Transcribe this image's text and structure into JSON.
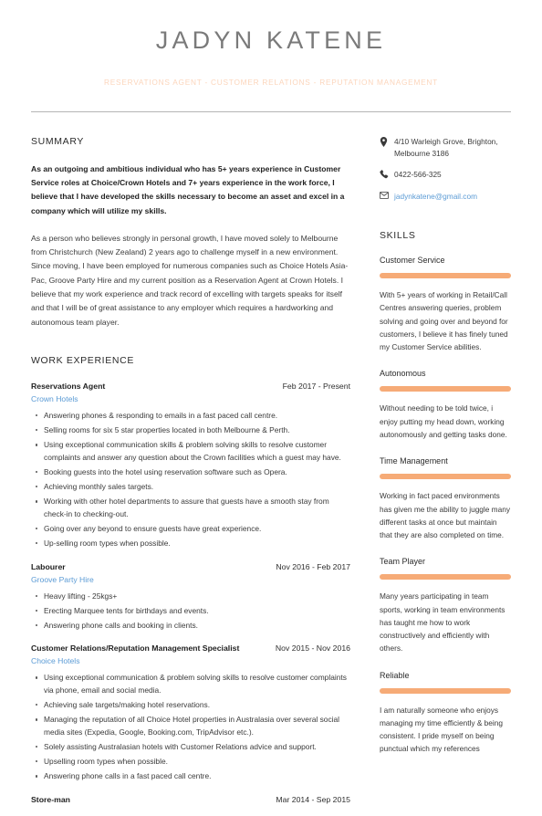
{
  "header": {
    "full_name": "JADYN KATENE",
    "headline": "RESERVATIONS AGENT - CUSTOMER RELATIONS - REPUTATION MANAGEMENT",
    "name_color": "#7a7a7a",
    "headline_color": "#fcd5bb"
  },
  "summary": {
    "title": "SUMMARY",
    "lead": "As an outgoing and ambitious individual who has 5+ years experience in Customer Service roles at Choice/Crown Hotels and 7+ years experience in the work force, I believe that I have developed the skills necessary to become an asset and excel in a company which will utilize my skills.",
    "body": "As a person who believes strongly in personal growth, I have moved solely to Melbourne from Christchurch (New Zealand) 2 years ago to challenge myself in a new environment. Since moving, I have been employed for numerous companies such as Choice Hotels Asia-Pac, Groove Party Hire and my current position as a Reservation Agent at Crown Hotels. I believe that my work experience and track record of excelling with targets speaks for itself and that I will be of great assistance to any employer which requires a hardworking and autonomous team player."
  },
  "experience": {
    "title": "WORK EXPERIENCE",
    "jobs": [
      {
        "title": "Reservations Agent",
        "dates": "Feb 2017 - Present",
        "company": "Crown Hotels",
        "bullets": [
          "Answering phones & responding to emails in a fast paced call centre.",
          "Selling rooms for six 5 star properties located in both Melbourne & Perth.",
          "Using exceptional communication skills & problem solving skills to resolve customer complaints and answer any question about the Crown facilities which a guest may have.",
          "Booking guests into the hotel using reservation software such as Opera.",
          "Achieving monthly sales targets.",
          "Working with other hotel departments to assure that guests have a smooth stay from check-in to checking-out.",
          "Going over any beyond to ensure guests have great experience.",
          "Up-selling room types when possible."
        ]
      },
      {
        "title": "Labourer",
        "dates": "Nov 2016 - Feb 2017",
        "company": "Groove Party Hire",
        "bullets": [
          "Heavy lifting - 25kgs+",
          "Erecting Marquee tents for birthdays and events.",
          "Answering phone calls and booking in clients."
        ]
      },
      {
        "title": "Customer Relations/Reputation Management Specialist",
        "dates": "Nov 2015 - Nov 2016",
        "company": "Choice Hotels",
        "bullets": [
          "Using exceptional communication & problem solving skills to resolve customer complaints via phone, email and social media.",
          "Achieving sale targets/making hotel reservations.",
          "Managing the reputation of  all Choice Hotel properties in Australasia over several social media sites (Expedia, Google, Booking.com, TripAdvisor etc.).",
          "Solely assisting Australasian hotels with Customer Relations advice and support.",
          "Upselling room types when possible.",
          "Answering phone calls in a fast paced call centre."
        ]
      },
      {
        "title": "Store-man",
        "dates": "Mar 2014 - Sep 2015",
        "company": "",
        "bullets": []
      }
    ]
  },
  "contact": {
    "address_line1": "4/10 Warleigh Grove, Brighton,",
    "address_line2": "Melbourne 3186",
    "phone": "0422-566-325",
    "email": "jadynkatene@gmail.com",
    "address_icon": "map-pin-icon",
    "phone_icon": "phone-icon",
    "email_icon": "envelope-icon",
    "email_color": "#5b9bd5"
  },
  "skills": {
    "title": "SKILLS",
    "bar_color": "#f6ab77",
    "items": [
      {
        "name": "Customer Service",
        "level": 100,
        "description": "With 5+ years of working in Retail/Call Centres answering queries, problem solving and going over and beyond for customers, I believe it has finely tuned my Customer Service abilities."
      },
      {
        "name": "Autonomous",
        "level": 100,
        "description": "Without needing to be told twice, i enjoy putting my head down, working autonomously and getting tasks done."
      },
      {
        "name": "Time Management",
        "level": 100,
        "description": "Working in fact paced environments has given me the ability to juggle many different tasks at once but maintain that they are also completed on time."
      },
      {
        "name": "Team Player",
        "level": 100,
        "description": "Many years participating in team sports, working in team environments has taught me how to work constructively and efficiently with others."
      },
      {
        "name": "Reliable",
        "level": 100,
        "description": "I am naturally someone who enjoys managing my time efficiently & being consistent. I pride myself on being punctual which my references"
      }
    ]
  }
}
